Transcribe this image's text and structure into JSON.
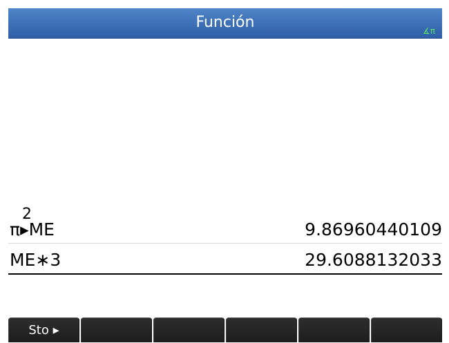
{
  "window": {
    "title": "Función",
    "angle_indicator": "∡π"
  },
  "history": {
    "rows": [
      {
        "expression_base": "π",
        "expression_superscript": "2",
        "expression_rest": "▸ME",
        "result": "9.86960440109"
      },
      {
        "expression_base": "ME∗3",
        "result": "29.6088132033"
      }
    ]
  },
  "softkeys": [
    {
      "label": "Sto ▸"
    },
    {
      "label": ""
    },
    {
      "label": ""
    },
    {
      "label": ""
    },
    {
      "label": ""
    },
    {
      "label": ""
    }
  ],
  "colors": {
    "title_bar": "#3f72b8",
    "angle_indicator": "#58e36c",
    "softkey_background": "#262626"
  }
}
